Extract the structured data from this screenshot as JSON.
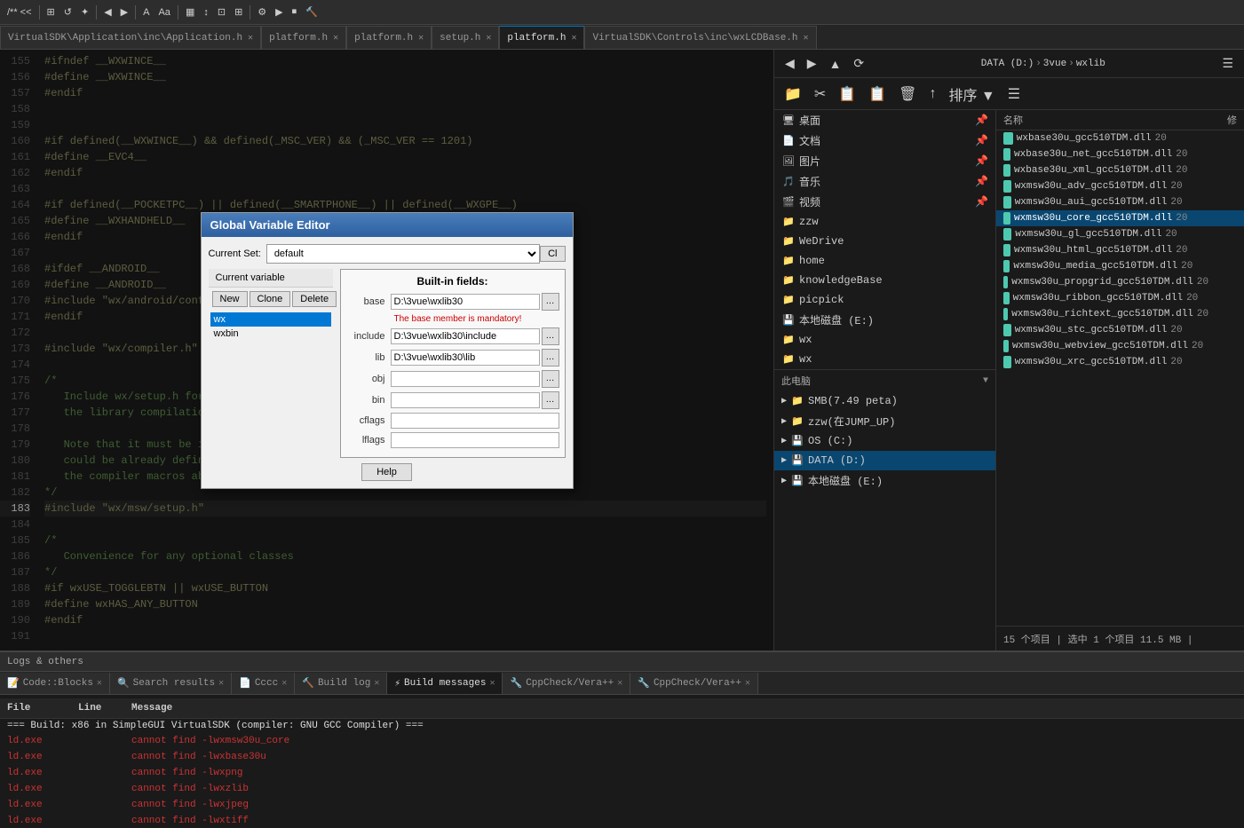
{
  "toolbar": {
    "buttons": [
      "◀◀",
      "**",
      "<<",
      ">>",
      "▶▶"
    ]
  },
  "tabs": [
    {
      "label": "Application.h",
      "path": "VirtualSDK\\Application\\inc\\Application.h",
      "active": false
    },
    {
      "label": "platform.h",
      "active": false
    },
    {
      "label": "platform.h",
      "active": false
    },
    {
      "label": "setup.h",
      "active": false
    },
    {
      "label": "platform.h",
      "active": true
    },
    {
      "label": "VirtualSDK\\Controls\\inc\\wxLCDBase.h",
      "active": false
    }
  ],
  "code": {
    "lines": [
      {
        "num": "155",
        "text": "#ifndef __WXWINCE__",
        "type": "pp"
      },
      {
        "num": "156",
        "text": "#define __WXWINCE__",
        "type": "pp"
      },
      {
        "num": "157",
        "text": "#endif",
        "type": "pp"
      },
      {
        "num": "158",
        "text": "",
        "type": ""
      },
      {
        "num": "159",
        "text": "",
        "type": ""
      },
      {
        "num": "160",
        "text": "#if defined(__WXWINCE__) && defined(_MSC_VER) && (_MSC_VER == 1201)",
        "type": "pp"
      },
      {
        "num": "161",
        "text": "#define __EVC4__",
        "type": "pp"
      },
      {
        "num": "162",
        "text": "#endif",
        "type": "pp"
      },
      {
        "num": "163",
        "text": "",
        "type": ""
      },
      {
        "num": "164",
        "text": "#if defined(__POCKETPC__) || defined(__SMARTPHONE__) || defined(__WXGPE__)",
        "type": "pp"
      },
      {
        "num": "165",
        "text": "#define __WXHANDHELD__",
        "type": "pp"
      },
      {
        "num": "166",
        "text": "#endif",
        "type": "pp"
      },
      {
        "num": "167",
        "text": "",
        "type": ""
      },
      {
        "num": "168",
        "text": "#ifdef __ANDROID__",
        "type": "pp"
      },
      {
        "num": "169",
        "text": "#define __ANDROID__",
        "type": "pp"
      },
      {
        "num": "170",
        "text": "#include \"wx/android/config_android.h\"",
        "type": "pp"
      },
      {
        "num": "171",
        "text": "#endif",
        "type": "pp"
      },
      {
        "num": "172",
        "text": "",
        "type": ""
      },
      {
        "num": "173",
        "text": "#include \"wx/compiler.h\"",
        "type": "pp"
      },
      {
        "num": "174",
        "text": "",
        "type": ""
      },
      {
        "num": "175",
        "text": "/*",
        "type": "comment"
      },
      {
        "num": "176",
        "text": "   Include wx/setup.h for the Unix plat",
        "type": "comment"
      },
      {
        "num": "177",
        "text": "   the library compilation options",
        "type": "comment"
      },
      {
        "num": "178",
        "text": "",
        "type": ""
      },
      {
        "num": "179",
        "text": "   Note that it must be included before",
        "type": "comment"
      },
      {
        "num": "180",
        "text": "   could be already defined by configur",
        "type": "comment"
      },
      {
        "num": "181",
        "text": "   the compiler macros above as msvs/wx",
        "type": "comment"
      },
      {
        "num": "182",
        "text": "*/",
        "type": "comment"
      },
      {
        "num": "183",
        "text": "#include \"wx/msw/setup.h\"",
        "type": "pp_highlight"
      },
      {
        "num": "184",
        "text": "",
        "type": ""
      },
      {
        "num": "185",
        "text": "/*",
        "type": "comment"
      },
      {
        "num": "186",
        "text": "   Convenience for any optional classes",
        "type": "comment"
      },
      {
        "num": "187",
        "text": "*/",
        "type": "comment"
      },
      {
        "num": "188",
        "text": "#if wxUSE_TOGGLEBTN || wxUSE_BUTTON",
        "type": "pp"
      },
      {
        "num": "189",
        "text": "#define wxHAS_ANY_BUTTON",
        "type": "pp"
      },
      {
        "num": "190",
        "text": "#endif",
        "type": "pp"
      },
      {
        "num": "191",
        "text": "",
        "type": ""
      }
    ]
  },
  "dialog": {
    "title": "Global Variable Editor",
    "current_set_label": "Current Set:",
    "current_set_value": "default",
    "close_btn": "Cl",
    "current_variable_label": "Current variable",
    "buttons": {
      "new": "New",
      "clone": "Clone",
      "delete": "Delete"
    },
    "variables": [
      {
        "name": "wx",
        "selected": true
      },
      {
        "name": "wxbin",
        "selected": false
      }
    ],
    "builtin_title": "Built-in fields:",
    "fields": [
      {
        "label": "base",
        "value": "D:\\3vue\\wxlib30",
        "note": "The base member is mandatory!"
      },
      {
        "label": "include",
        "value": "D:\\3vue\\wxlib30\\include",
        "note": ""
      },
      {
        "label": "lib",
        "value": "D:\\3vue\\wxlib30\\lib",
        "note": ""
      },
      {
        "label": "obj",
        "value": "",
        "note": ""
      },
      {
        "label": "bin",
        "value": "",
        "note": ""
      },
      {
        "label": "cflags",
        "value": "",
        "note": ""
      },
      {
        "label": "lflags",
        "value": "",
        "note": ""
      }
    ],
    "help_btn": "Help"
  },
  "right_panel": {
    "nav": {
      "back": "◀",
      "forward": "▶",
      "up": "▲",
      "refresh": "⟳",
      "path": [
        "DATA (D:)",
        "3vue",
        "wxlib"
      ]
    },
    "toolbar_icons": [
      "📁",
      "✂",
      "📋",
      "📋",
      "🗑",
      "↑",
      "排序▼",
      "☰"
    ],
    "tree_items": [
      {
        "label": "桌面",
        "pinned": true,
        "icon": "🖥"
      },
      {
        "label": "文档",
        "pinned": true,
        "icon": "📄"
      },
      {
        "label": "图片",
        "pinned": true,
        "icon": "🖼"
      },
      {
        "label": "音乐",
        "pinned": true,
        "icon": "🎵"
      },
      {
        "label": "视频",
        "pinned": true,
        "icon": "🎬"
      },
      {
        "label": "zzw",
        "pinned": false,
        "icon": "📁"
      },
      {
        "label": "WeDrive",
        "pinned": false,
        "icon": "📁"
      },
      {
        "label": "home",
        "pinned": false,
        "icon": "📁"
      },
      {
        "label": "knowledgeBase",
        "pinned": false,
        "icon": "📁"
      },
      {
        "label": "picpick",
        "pinned": false,
        "icon": "📁"
      },
      {
        "label": "本地磁盘 (E:)",
        "pinned": false,
        "icon": "💾"
      },
      {
        "label": "wx",
        "pinned": false,
        "icon": "📁"
      },
      {
        "label": "wx",
        "pinned": false,
        "icon": "📁"
      }
    ],
    "computer_section": {
      "label": "此电脑",
      "items": [
        {
          "label": "SMB(7.49 peta)",
          "icon": "📁"
        },
        {
          "label": "zzw(在JUMP_UP)",
          "icon": "📁"
        },
        {
          "label": "OS (C:)",
          "icon": "💾"
        },
        {
          "label": "DATA (D:)",
          "icon": "💾",
          "selected": true
        },
        {
          "label": "本地磁盘 (E:)",
          "icon": "💾"
        }
      ]
    },
    "files_header": {
      "name_col": "名称",
      "mod_col": "修"
    },
    "files": [
      {
        "name": "wxbase30u_gcc510TDM.dll",
        "date": "20"
      },
      {
        "name": "wxbase30u_net_gcc510TDM.dll",
        "date": "20"
      },
      {
        "name": "wxbase30u_xml_gcc510TDM.dll",
        "date": "20"
      },
      {
        "name": "wxmsw30u_adv_gcc510TDM.dll",
        "date": "20"
      },
      {
        "name": "wxmsw30u_aui_gcc510TDM.dll",
        "date": "20"
      },
      {
        "name": "wxmsw30u_core_gcc510TDM.dll",
        "date": "20",
        "selected": true
      },
      {
        "name": "wxmsw30u_gl_gcc510TDM.dll",
        "date": "20"
      },
      {
        "name": "wxmsw30u_html_gcc510TDM.dll",
        "date": "20"
      },
      {
        "name": "wxmsw30u_media_gcc510TDM.dll",
        "date": "20"
      },
      {
        "name": "wxmsw30u_propgrid_gcc510TDM.dll",
        "date": "20"
      },
      {
        "name": "wxmsw30u_ribbon_gcc510TDM.dll",
        "date": "20"
      },
      {
        "name": "wxmsw30u_richtext_gcc510TDM.dll",
        "date": "20"
      },
      {
        "name": "wxmsw30u_stc_gcc510TDM.dll",
        "date": "20"
      },
      {
        "name": "wxmsw30u_webview_gcc510TDM.dll",
        "date": "20"
      },
      {
        "name": "wxmsw30u_xrc_gcc510TDM.dll",
        "date": "20"
      }
    ],
    "status": "15 个项目 | 选中 1 个项目 11.5 MB |"
  },
  "logs": {
    "header": "Logs & others",
    "tabs": [
      {
        "label": "Code::Blocks",
        "active": false,
        "icon": "📝"
      },
      {
        "label": "Search results",
        "active": false,
        "icon": "🔍"
      },
      {
        "label": "Cccc",
        "active": false,
        "icon": "📄"
      },
      {
        "label": "Build log",
        "active": false,
        "icon": "🔨"
      },
      {
        "label": "Build messages",
        "active": true,
        "icon": "⚡"
      },
      {
        "label": "CppCheck/Vera++",
        "active": false,
        "icon": "🔧"
      },
      {
        "label": "CppCheck/Vera++",
        "active": false,
        "icon": "🔧"
      }
    ],
    "columns": [
      "File",
      "Line",
      "Message"
    ],
    "build_header": "=== Build: x86 in SimpleGUI VirtualSDK (compiler: GNU GCC Compiler) ===",
    "rows": [
      {
        "file": "ld.exe",
        "line": "",
        "msg": "cannot find -lwxmsw30u_core"
      },
      {
        "file": "ld.exe",
        "line": "",
        "msg": "cannot find -lwxbase30u"
      },
      {
        "file": "ld.exe",
        "line": "",
        "msg": "cannot find -lwxpng"
      },
      {
        "file": "ld.exe",
        "line": "",
        "msg": "cannot find -lwxzlib"
      },
      {
        "file": "ld.exe",
        "line": "",
        "msg": "cannot find -lwxjpeg"
      },
      {
        "file": "ld.exe",
        "line": "",
        "msg": "cannot find -lwxtiff"
      }
    ]
  }
}
